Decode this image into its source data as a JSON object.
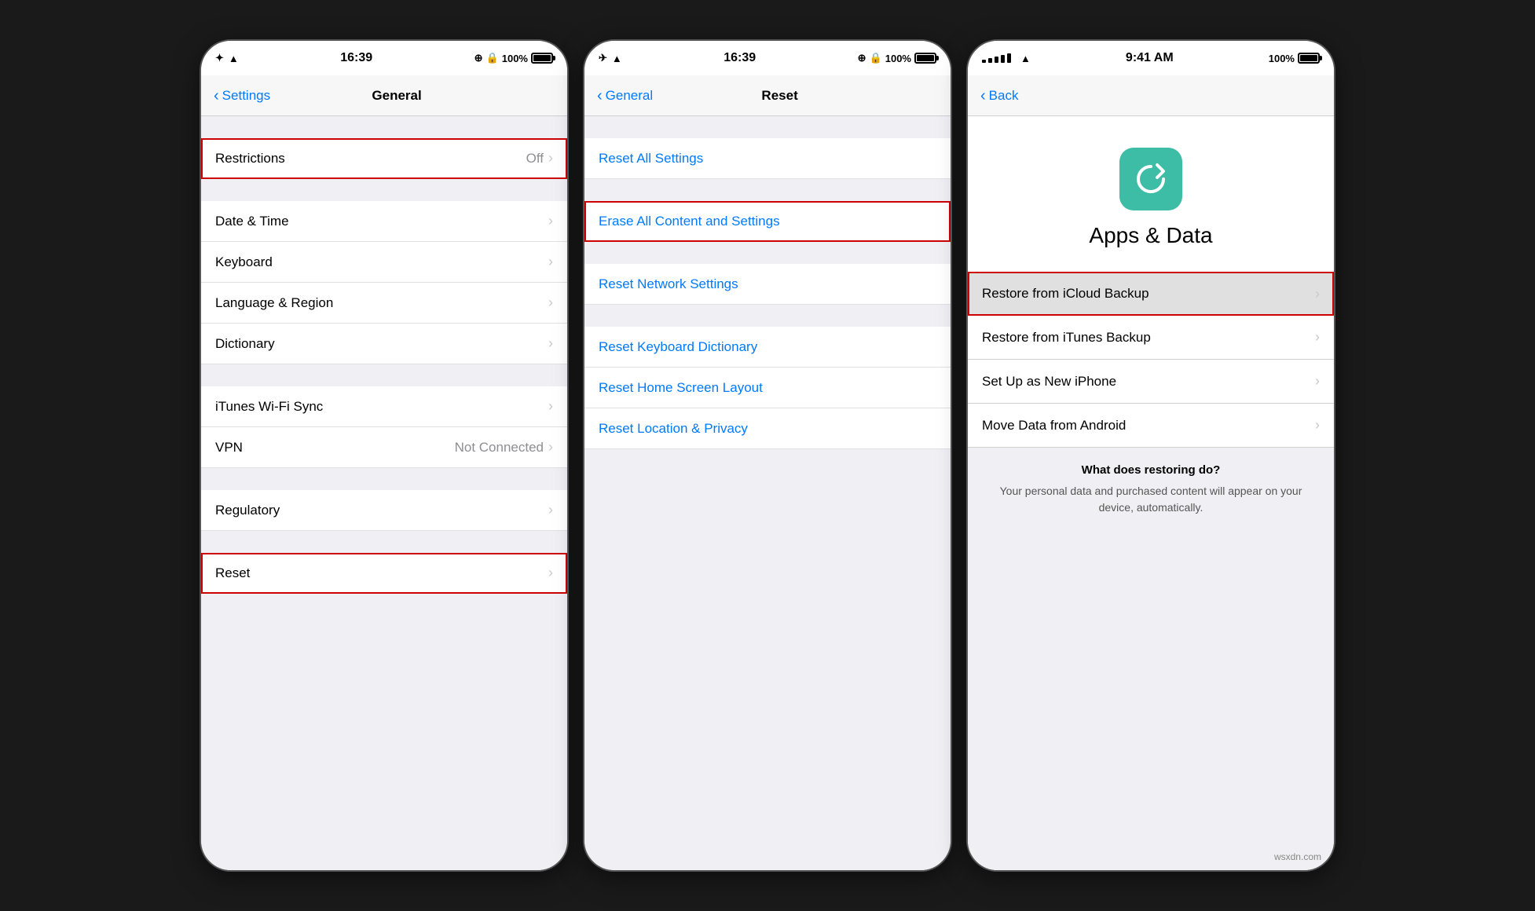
{
  "colors": {
    "blue": "#007aff",
    "red_outline": "#cc0000",
    "teal": "#3dbda5",
    "gray_bg": "#efeff4",
    "white": "#ffffff",
    "separator": "#d0d0d0",
    "text_black": "#000000",
    "text_gray": "#8e8e93",
    "chevron": "#c8c8cc"
  },
  "phone1": {
    "status": {
      "left": "▲  ✦",
      "time": "16:39",
      "right_text": "100%"
    },
    "nav": {
      "back_label": "Settings",
      "title": "General"
    },
    "rows": [
      {
        "label": "Restrictions",
        "value": "Off",
        "hasChevron": true,
        "redBox": true
      },
      {
        "label": "Date & Time",
        "value": "",
        "hasChevron": true
      },
      {
        "label": "Keyboard",
        "value": "",
        "hasChevron": true
      },
      {
        "label": "Language & Region",
        "value": "",
        "hasChevron": true
      },
      {
        "label": "Dictionary",
        "value": "",
        "hasChevron": true
      },
      {
        "label": "iTunes Wi-Fi Sync",
        "value": "",
        "hasChevron": true
      },
      {
        "label": "VPN",
        "value": "Not Connected",
        "hasChevron": true
      },
      {
        "label": "Regulatory",
        "value": "",
        "hasChevron": true
      },
      {
        "label": "Reset",
        "value": "",
        "hasChevron": true,
        "redBox": true
      }
    ]
  },
  "phone2": {
    "status": {
      "time": "16:39",
      "right_text": "100%"
    },
    "nav": {
      "back_label": "General",
      "title": "Reset"
    },
    "rows": [
      {
        "label": "Reset All Settings",
        "isBlue": true,
        "redBox": false
      },
      {
        "label": "Erase All Content and Settings",
        "isBlue": true,
        "redBox": true
      },
      {
        "label": "Reset Network Settings",
        "isBlue": true,
        "redBox": false
      },
      {
        "label": "Reset Keyboard Dictionary",
        "isBlue": true,
        "redBox": false
      },
      {
        "label": "Reset Home Screen Layout",
        "isBlue": true,
        "redBox": false
      },
      {
        "label": "Reset Location & Privacy",
        "isBlue": true,
        "redBox": false
      }
    ]
  },
  "phone3": {
    "status": {
      "dots": 5,
      "carrier": "●●●●●",
      "time": "9:41 AM",
      "right_text": "100%"
    },
    "nav": {
      "back_label": "Back"
    },
    "apps_data": {
      "icon_label": "↺",
      "title": "Apps & Data",
      "rows": [
        {
          "label": "Restore from iCloud Backup",
          "hasChevron": true,
          "redBox": true,
          "selected": true
        },
        {
          "label": "Restore from iTunes Backup",
          "hasChevron": true,
          "redBox": false
        },
        {
          "label": "Set Up as New iPhone",
          "hasChevron": true,
          "redBox": false
        },
        {
          "label": "Move Data from Android",
          "hasChevron": true,
          "redBox": false
        }
      ],
      "what_does_title": "What does restoring do?",
      "what_does_body": "Your personal data and purchased content\nwill appear on your device, automatically."
    }
  },
  "watermark": "wsxdn.com"
}
